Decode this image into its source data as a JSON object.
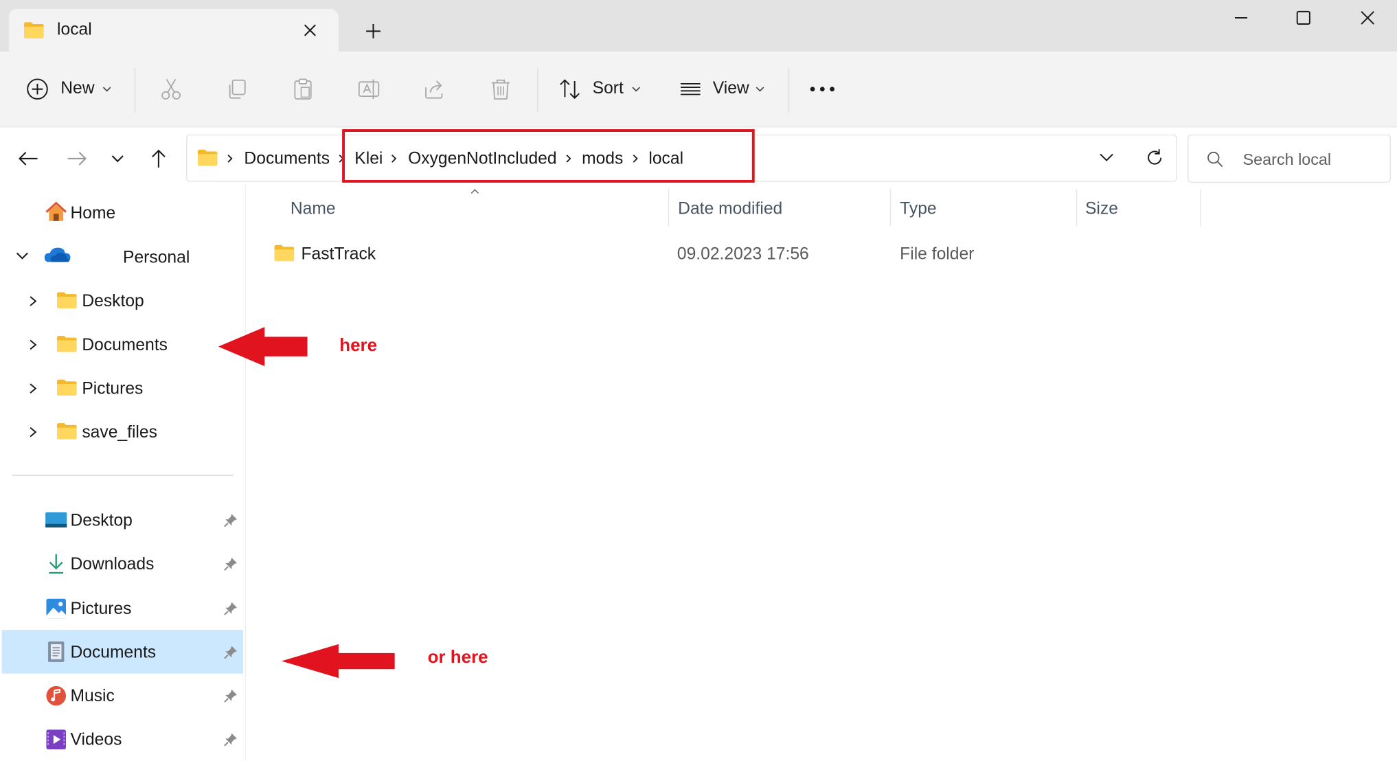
{
  "window": {
    "tab_title": "local"
  },
  "toolbar": {
    "new_label": "New",
    "sort_label": "Sort",
    "view_label": "View"
  },
  "address": {
    "crumbs": [
      "Documents",
      "Klei",
      "OxygenNotIncluded",
      "mods",
      "local"
    ]
  },
  "search": {
    "placeholder": "Search local"
  },
  "sidebar": {
    "home": "Home",
    "onedrive": "Personal",
    "tree": [
      "Desktop",
      "Documents",
      "Pictures",
      "save_files"
    ],
    "quick_access": [
      "Desktop",
      "Downloads",
      "Pictures",
      "Documents",
      "Music",
      "Videos"
    ]
  },
  "content": {
    "columns": [
      "Name",
      "Date modified",
      "Type",
      "Size"
    ],
    "rows": [
      {
        "name": "FastTrack",
        "date_modified": "09.02.2023 17:56",
        "type": "File folder",
        "size": ""
      }
    ]
  },
  "annotations": {
    "arrow_1_text": "here",
    "arrow_2_text": "or here"
  },
  "colors": {
    "accent": "#0067c0",
    "annotation_red": "#e0131e",
    "selection": "#cce8ff",
    "folder_yellow": "#ffc83d"
  }
}
